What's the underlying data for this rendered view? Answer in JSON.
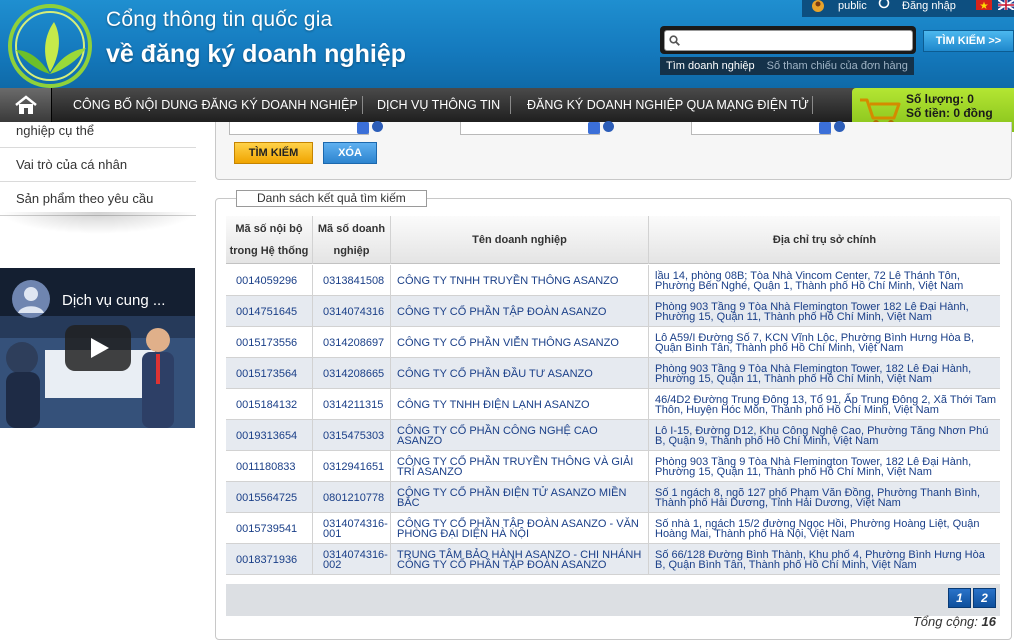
{
  "header": {
    "title_line1": "Cổng thông tin quốc gia",
    "title_line2": "về đăng ký doanh nghiệp",
    "topbar": {
      "user": "public",
      "login": "Đăng nhập"
    },
    "search": {
      "placeholder": "",
      "button": "TÌM KIẾM >>",
      "tabs": [
        "Tìm doanh nghiệp",
        "Số tham chiếu của đơn hàng"
      ],
      "active_tab": 0
    }
  },
  "nav": {
    "items": [
      "CÔNG BỐ NỘI DUNG ĐĂNG KÝ DOANH NGHIỆP",
      "DỊCH VỤ THÔNG TIN",
      "ĐĂNG KÝ DOANH NGHIỆP QUA MẠNG ĐIỆN TỬ"
    ],
    "cart": {
      "quantity_label": "Số lượng: 0",
      "amount_label": "Số tiền: 0 đồng"
    }
  },
  "sidebar": {
    "items": [
      "nghiệp cụ thể",
      "Vai trò của cá nhân",
      "Sản phẩm theo yêu cầu"
    ],
    "video_title": "Dịch vụ cung ..."
  },
  "form": {
    "search_button": "TÌM KIẾM",
    "clear_button": "XÓA"
  },
  "results": {
    "legend": "Danh sách kết quả tìm kiếm",
    "columns": {
      "internal_id": "Mã số nội bộ trong Hệ thống",
      "tax_id": "Mã số doanh nghiệp",
      "name": "Tên doanh nghiệp",
      "address": "Địa chỉ trụ sở chính"
    },
    "rows": [
      {
        "internal_id": "0014059296",
        "tax_id": "0313841508",
        "name": "CÔNG TY TNHH TRUYỀN THÔNG ASANZO",
        "address": "lầu 14, phòng 08B; Tòa Nhà Vincom Center, 72 Lê Thánh Tôn, Phường Bến Nghé, Quận 1, Thành phố Hồ Chí Minh, Việt Nam"
      },
      {
        "internal_id": "0014751645",
        "tax_id": "0314074316",
        "name": "CÔNG TY CỔ PHẦN TẬP ĐOÀN ASANZO",
        "address": "Phòng 903 Tầng 9 Tòa Nhà Flemington Tower 182 Lê Đại Hành, Phường 15, Quận 11, Thành phố Hồ Chí Minh, Việt Nam"
      },
      {
        "internal_id": "0015173556",
        "tax_id": "0314208697",
        "name": "CÔNG TY CỔ PHẦN VIỄN THÔNG ASANZO",
        "address": "Lô A59/I Đường Số 7, KCN Vĩnh Lộc, Phường Bình Hưng Hòa B, Quận Bình Tân, Thành phố Hồ Chí Minh, Việt Nam"
      },
      {
        "internal_id": "0015173564",
        "tax_id": "0314208665",
        "name": "CÔNG TY CỔ PHẦN ĐẦU TƯ ASANZO",
        "address": "Phòng 903 Tầng 9 Tòa Nhà Flemington Tower, 182 Lê Đại Hành, Phường 15, Quận 11, Thành phố Hồ Chí Minh, Việt Nam"
      },
      {
        "internal_id": "0015184132",
        "tax_id": "0314211315",
        "name": "CÔNG TY TNHH ĐIỆN LẠNH ASANZO",
        "address": "46/4D2 Đường Trung Đông 13, Tổ 91, Ấp Trung Đông 2, Xã Thới Tam Thôn, Huyện Hóc Môn, Thành phố Hồ Chí Minh, Việt Nam"
      },
      {
        "internal_id": "0019313654",
        "tax_id": "0315475303",
        "name": "CÔNG TY CỔ PHẦN CÔNG NGHỆ CAO ASANZO",
        "address": "Lô I-15, Đường D12, Khu Công Nghệ Cao, Phường Tăng Nhơn Phú B, Quận 9, Thành phố Hồ Chí Minh, Việt Nam"
      },
      {
        "internal_id": "0011180833",
        "tax_id": "0312941651",
        "name": "CÔNG TY CỔ PHẦN TRUYỀN THÔNG VÀ GIẢI TRÍ ASANZO",
        "address": "Phòng 903 Tầng 9 Tòa Nhà Flemington Tower, 182 Lê Đại Hành, Phường 15, Quận 11, Thành phố Hồ Chí Minh, Việt Nam"
      },
      {
        "internal_id": "0015564725",
        "tax_id": "0801210778",
        "name": "CÔNG TY CỔ PHẦN ĐIỆN TỬ ASANZO MIỀN BẮC",
        "address": "Số 1 ngách 8, ngõ 127 phố Phạm Văn Đồng, Phường Thanh Bình, Thành phố Hải Dương, Tỉnh Hải Dương, Việt Nam"
      },
      {
        "internal_id": "0015739541",
        "tax_id": "0314074316-001",
        "name": "CÔNG TY CỔ PHẦN TẬP ĐOÀN ASANZO - VĂN PHÒNG ĐẠI DIỆN HÀ NỘI",
        "address": "Số nhà 1, ngách 15/2 đường Ngọc Hồi, Phường Hoàng Liệt, Quận Hoàng Mai, Thành phố Hà Nội, Việt Nam"
      },
      {
        "internal_id": "0018371936",
        "tax_id": "0314074316-002",
        "name": "TRUNG TÂM BẢO HÀNH ASANZO - CHI NHÁNH CÔNG TY CỔ PHẦN TẬP ĐOÀN ASANZO",
        "address": "Số 66/128 Đường Bình Thành, Khu phố 4, Phường Bình Hưng Hòa B, Quận Bình Tân, Thành phố Hồ Chí Minh, Việt Nam"
      }
    ],
    "pages": [
      "1",
      "2"
    ],
    "total_label": "Tổng cộng:",
    "total_value": "16"
  },
  "colors": {
    "header_blue": "#1479bd",
    "nav_dark": "#2a2a2a",
    "cart_green": "#9ad424",
    "link_blue": "#1a3f88",
    "button_orange": "#f5b800"
  }
}
